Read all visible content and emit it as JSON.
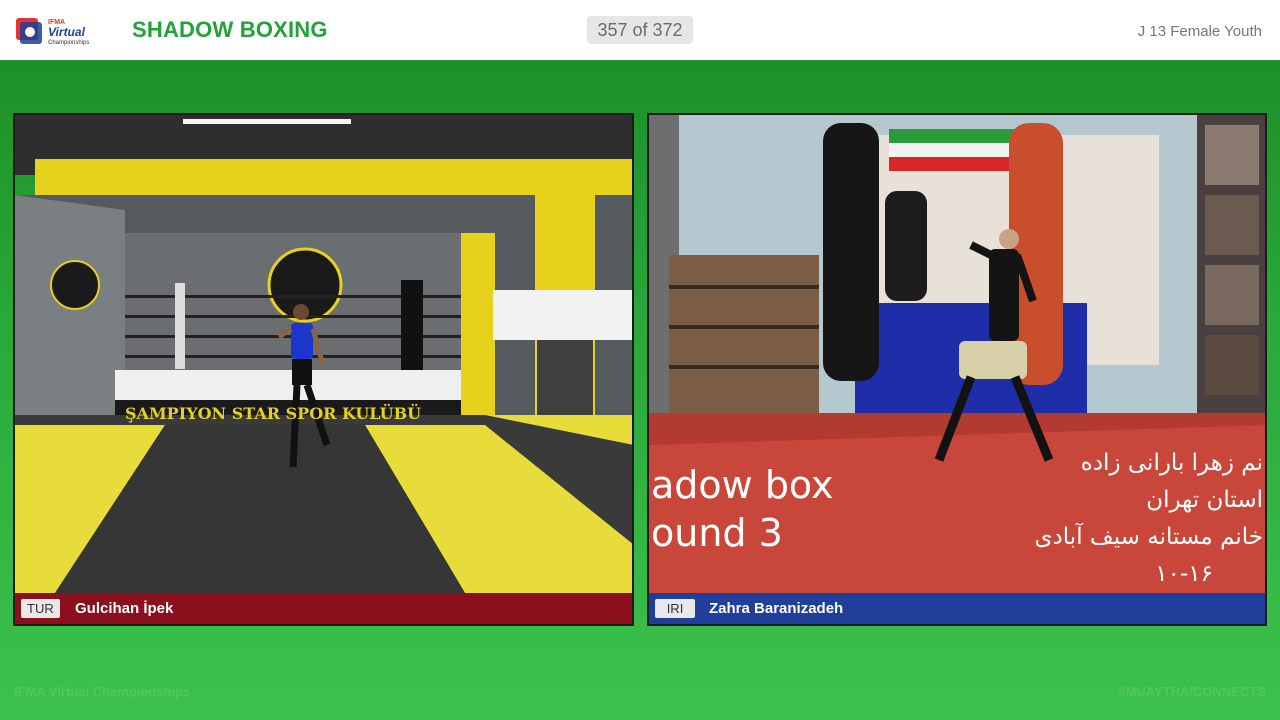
{
  "header": {
    "logo_text": "Virtual",
    "logo_sub": "Championships",
    "title": "SHADOW BOXING",
    "counter": "357 of 372",
    "category": "J 13 Female Youth"
  },
  "left_panel": {
    "country": "TUR",
    "name": "Gulcihan İpek",
    "ring_banner": "ŞAMPIYON STAR SPOR KULÜBÜ",
    "ring_logo": "ŞAMPIYON STAR"
  },
  "right_panel": {
    "country": "IRI",
    "name": "Zahra Baranizadeh",
    "overlay_lines": [
      "adow box",
      "ound 3"
    ],
    "overlay_rtl": [
      "نم زهرا بارانی زاده",
      "استان تهران",
      "خانم مستانه سیف آبادی",
      "۱۰-۱۶"
    ]
  },
  "footer": {
    "left": "IFMA Virtual Championships",
    "right": "#MUAYTHAICONNECTS"
  },
  "colors": {
    "brand_green": "#22a33a",
    "red_corner": "#8c0f1e",
    "blue_corner": "#1f3f9a"
  }
}
